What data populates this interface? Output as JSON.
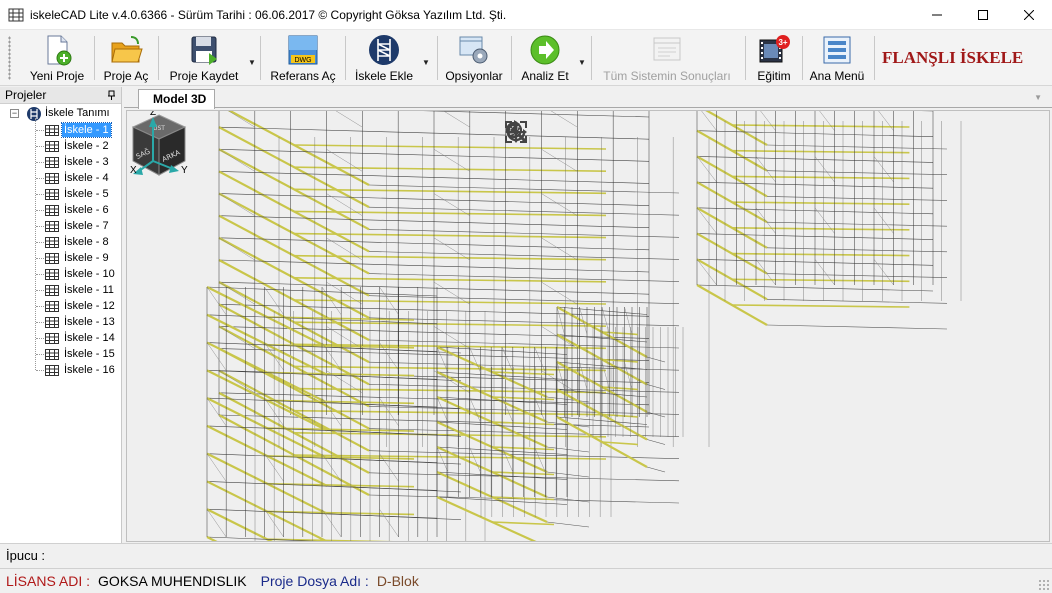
{
  "window": {
    "title": "iskeleCAD Lite v.4.0.6366 - Sürüm Tarihi : 06.06.2017  © Copyright Göksa Yazılım Ltd. Şti."
  },
  "toolbar": {
    "items": [
      {
        "label": "Yeni Proje",
        "icon": "new-project-icon"
      },
      {
        "label": "Proje Aç",
        "icon": "open-folder-icon"
      },
      {
        "label": "Proje Kaydet",
        "icon": "save-icon"
      },
      {
        "label": "Referans Aç",
        "icon": "dwg-icon"
      },
      {
        "label": "İskele Ekle",
        "icon": "scaffold-icon"
      },
      {
        "label": "Opsiyonlar",
        "icon": "options-icon"
      },
      {
        "label": "Analiz Et",
        "icon": "run-icon"
      },
      {
        "label": "Tüm Sistemin Sonuçları",
        "icon": "results-icon",
        "disabled": true
      },
      {
        "label": "Eğitim",
        "icon": "film-icon",
        "badge": "3+"
      },
      {
        "label": "Ana Menü",
        "icon": "menu-icon"
      }
    ],
    "brand": "FLANŞLI İSKELE"
  },
  "left_panel": {
    "title": "Projeler",
    "pin_icon": "pin-icon",
    "root": "İskele Tanımı",
    "items": [
      "İskele - 1",
      "İskele - 2",
      "İskele - 3",
      "İskele - 4",
      "İskele - 5",
      "İskele - 6",
      "İskele - 7",
      "İskele - 8",
      "İskele - 9",
      "İskele - 10",
      "İskele - 11",
      "İskele - 12",
      "İskele - 13",
      "İskele - 14",
      "İskele - 15",
      "İskele - 16"
    ],
    "selected_index": 0
  },
  "viewport": {
    "tab": "Model 3D",
    "viewcube": {
      "top": "ÜST",
      "left": "SAĞ",
      "right": "ARKA"
    },
    "axes": {
      "z": "Z",
      "x": "X",
      "y": "Y"
    }
  },
  "status": {
    "hint_label": "İpucu :",
    "license_label": "LİSANS ADI :",
    "license_value": "GOKSA MUHENDISLIK",
    "project_label": "Proje Dosya Adı :",
    "project_value": "D-Blok"
  },
  "colors": {
    "brand": "#a01818",
    "selection": "#3399ff",
    "plank": "#c9c64a"
  }
}
